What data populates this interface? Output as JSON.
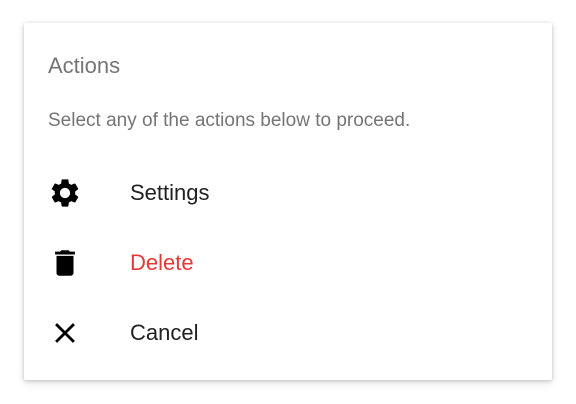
{
  "dialog": {
    "title": "Actions",
    "message": "Select any of the actions below to proceed.",
    "actions": [
      {
        "label": "Settings",
        "icon": "gear-icon"
      },
      {
        "label": "Delete",
        "icon": "trash-icon",
        "color": "#e53935"
      },
      {
        "label": "Cancel",
        "icon": "close-icon"
      }
    ]
  }
}
